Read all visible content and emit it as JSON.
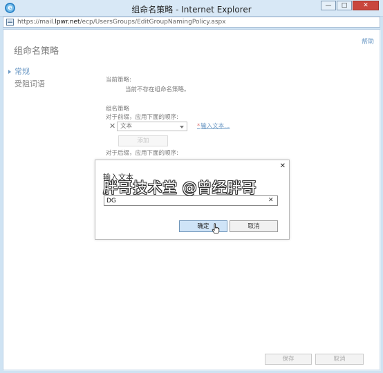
{
  "window": {
    "title": "组命名策略 - Internet Explorer",
    "minimize": "—",
    "maximize": "□",
    "close": "✕",
    "url_prefix": "https://mail.",
    "url_domain": "lpwr.net",
    "url_path": "/ecp/UsersGroups/EditGroupNamingPolicy.aspx"
  },
  "page": {
    "help": "帮助",
    "title": "组命名策略"
  },
  "nav": {
    "items": [
      {
        "label": "常规",
        "active": true
      },
      {
        "label": "受阻词语",
        "active": false
      }
    ]
  },
  "policy": {
    "current_label": "当前策略:",
    "current_value": "当前不存在组命名策略。",
    "group_naming_label": "组名策略",
    "prefix_label": "对于前缀，应用下面的顺序:",
    "row_remove": "✕",
    "row_type": "文本",
    "enter_text_required": "*",
    "enter_text_link": "输入文本...",
    "add_button": "添加",
    "suffix_label": "对于后缀，应用下面的顺序:"
  },
  "dialog": {
    "close": "✕",
    "title": "输入文本",
    "input_value": "DG",
    "clear": "✕",
    "ok": "确定",
    "cancel": "取消"
  },
  "watermark": "胖哥技术堂 @曾经胖哥",
  "footer": {
    "save": "保存",
    "cancel": "取消"
  }
}
